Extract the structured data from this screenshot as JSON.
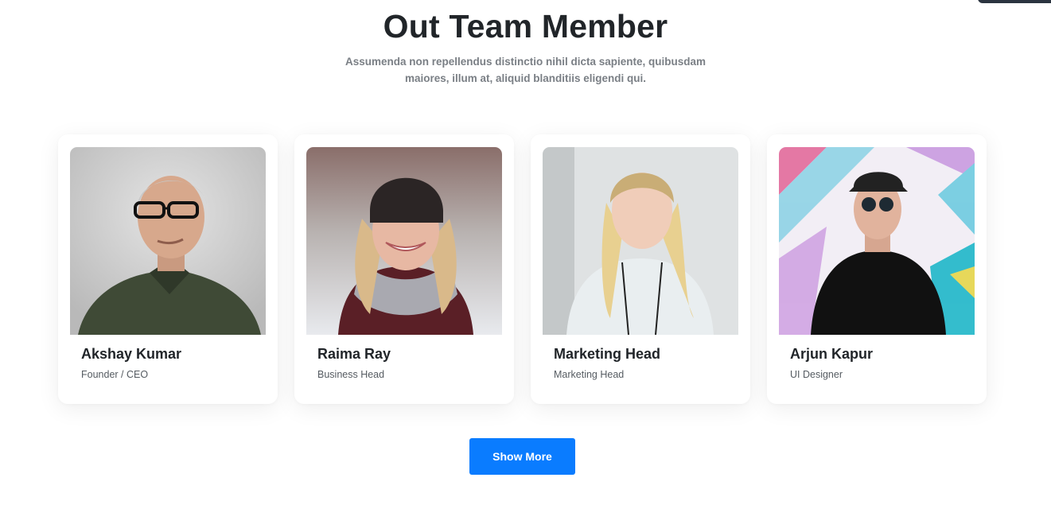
{
  "section": {
    "title": "Out Team Member",
    "subtitle": "Assumenda non repellendus distinctio nihil dicta sapiente, quibusdam maiores, illum at, aliquid blanditiis eligendi qui."
  },
  "members": [
    {
      "name": "Akshay Kumar",
      "role": "Founder / CEO"
    },
    {
      "name": "Raima Ray",
      "role": "Business Head"
    },
    {
      "name": "Marketing Head",
      "role": "Marketing Head"
    },
    {
      "name": "Arjun Kapur",
      "role": "UI Designer"
    }
  ],
  "actions": {
    "show_more_label": "Show More"
  },
  "colors": {
    "accent": "#0a7cff",
    "title": "#212529",
    "subtitle": "#7a7f85"
  }
}
